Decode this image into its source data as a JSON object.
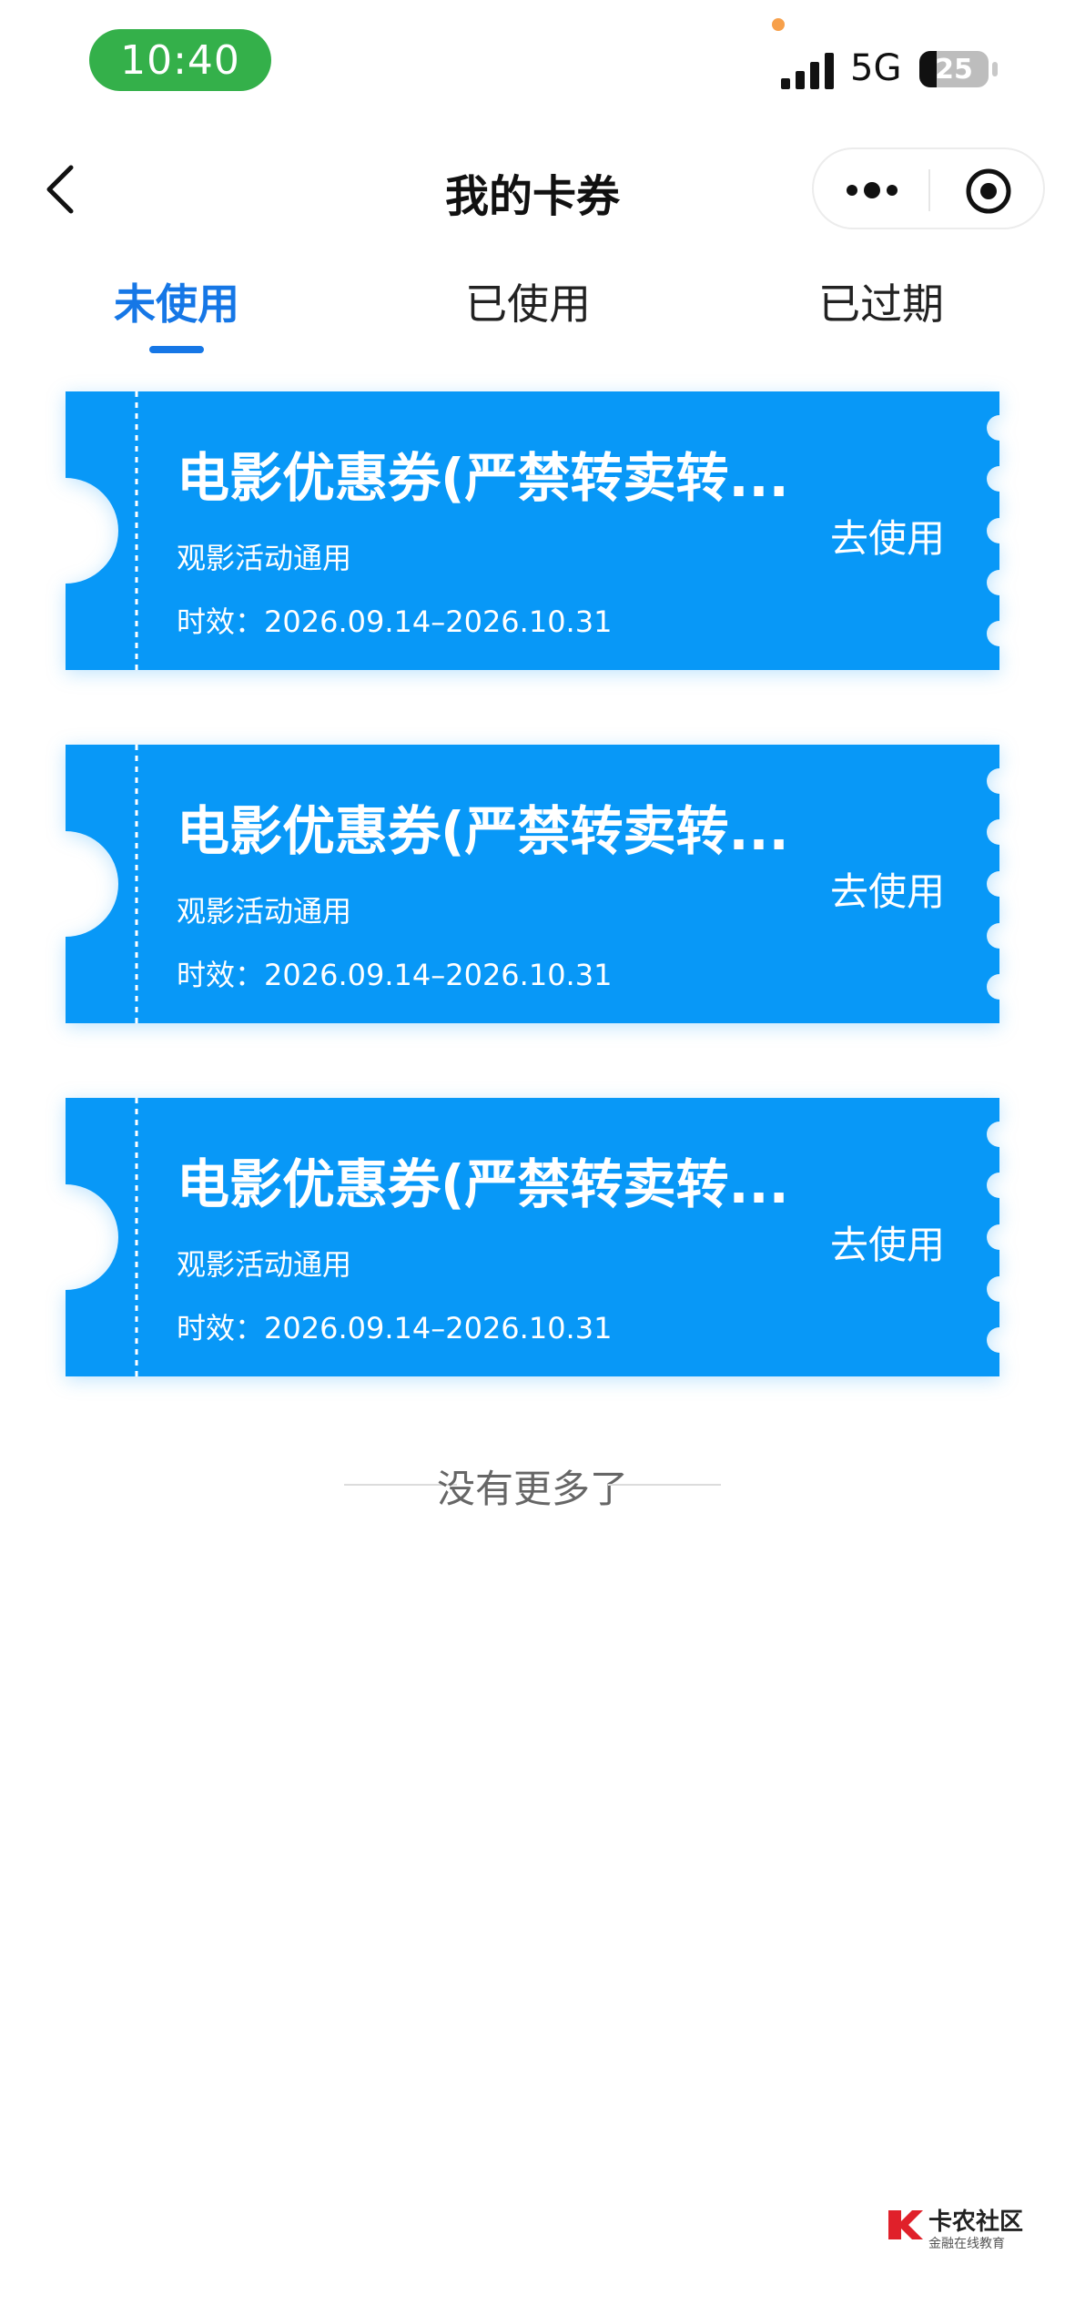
{
  "status_bar": {
    "time": "10:40",
    "network": "5G",
    "battery_level": "25",
    "battery_fraction": 0.25
  },
  "nav": {
    "title": "我的卡券"
  },
  "tabs": [
    {
      "label": "未使用",
      "active": true
    },
    {
      "label": "已使用",
      "active": false
    },
    {
      "label": "已过期",
      "active": false
    }
  ],
  "coupons": [
    {
      "name": "电影优惠券(严禁转卖转...",
      "desc": "观影活动通用",
      "validity": "时效：2026.09.14–2026.10.31",
      "action": "去使用"
    },
    {
      "name": "电影优惠券(严禁转卖转...",
      "desc": "观影活动通用",
      "validity": "时效：2026.09.14–2026.10.31",
      "action": "去使用"
    },
    {
      "name": "电影优惠券(严禁转卖转...",
      "desc": "观影活动通用",
      "validity": "时效：2026.09.14–2026.10.31",
      "action": "去使用"
    }
  ],
  "list_end_text": "没有更多了",
  "watermark": {
    "title": "卡农社区",
    "subtitle": "金融在线教育"
  },
  "colors": {
    "accent": "#1677e6",
    "coupon": "#0898f7",
    "status_green": "#34b04a"
  }
}
